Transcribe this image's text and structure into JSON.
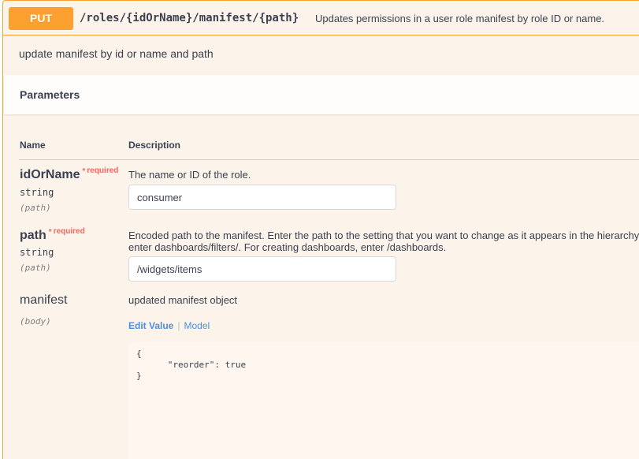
{
  "operation": {
    "method": "PUT",
    "path": "/roles/{idOrName}/manifest/{path}",
    "summary": "Updates permissions in a user role manifest by role ID or name.",
    "description": "update manifest by id or name and path"
  },
  "parameters": {
    "title": "Parameters",
    "columns": {
      "name": "Name",
      "description": "Description"
    },
    "items": [
      {
        "name": "idOrName",
        "required_star": "*",
        "required_label": "required",
        "type": "string",
        "in": "(path)",
        "description": "The name or ID of the role.",
        "value": "consumer"
      },
      {
        "name": "path",
        "required_star": "*",
        "required_label": "required",
        "type": "string",
        "in": "(path)",
        "description_line1": "Encoded path to the manifest. Enter the path to the setting that you want to change as it appears in the hierarchy",
        "description_line2": "enter dashboards/filters/. For creating dashboards, enter /dashboards.",
        "value": "/widgets/items"
      },
      {
        "name": "manifest",
        "in": "(body)",
        "description": "updated manifest object",
        "tabs": {
          "edit": "Edit Value",
          "separator": "|",
          "model": "Model"
        },
        "body_value": "{\n      \"reorder\": true\n}"
      }
    ]
  },
  "colors": {
    "put": "#fca130",
    "required": "#ff6666",
    "link": "#4990e2"
  }
}
